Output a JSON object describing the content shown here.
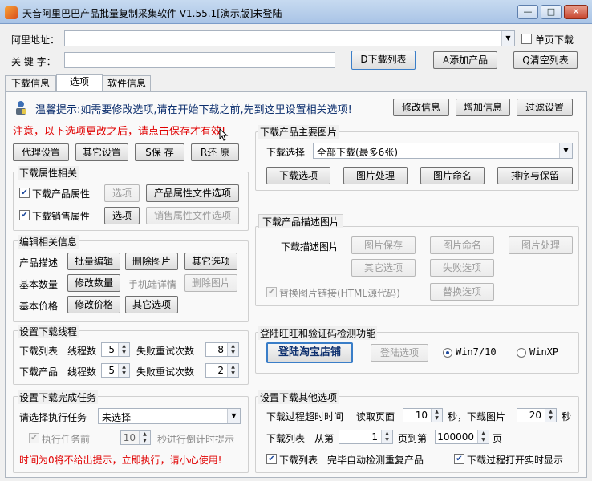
{
  "window": {
    "title": "天音阿里巴巴产品批量复制采集软件 V1.55.1[演示版]未登陆",
    "controls": {
      "minimize": "—",
      "maximize": "□",
      "close": "✕"
    }
  },
  "top": {
    "ali_label": "阿里地址：",
    "ali_value": "",
    "single_page_label": "单页下载",
    "keyword_label": "关 键 字：",
    "keyword_value": "",
    "btn_download_list": "D下载列表",
    "btn_add_product": "A添加产品",
    "btn_clear_list": "Q清空列表"
  },
  "tabs": [
    "下载信息",
    "选项",
    "软件信息"
  ],
  "hint": {
    "text": "温馨提示:如需要修改选项,请在开始下载之前,先到这里设置相关选项!",
    "btn_modify": "修改信息",
    "btn_add": "增加信息",
    "btn_filter": "过滤设置"
  },
  "notice": "注意，以下选项更改之后，请点击保存才有效!",
  "actions": {
    "proxy": "代理设置",
    "other": "其它设置",
    "save": "S保 存",
    "restore": "R还 原"
  },
  "attr_group": {
    "title": "下载属性相关",
    "row1_label": "下载产品属性",
    "row1_opt": "选项",
    "row1_file": "产品属性文件选项",
    "row2_label": "下载销售属性",
    "row2_opt": "选项",
    "row2_file": "销售属性文件选项"
  },
  "edit_group": {
    "title": "编辑相关信息",
    "desc_label": "产品描述",
    "desc_b1": "批量编辑",
    "desc_b2": "删除图片",
    "desc_b3": "其它选项",
    "qty_label": "基本数量",
    "qty_b1": "修改数量",
    "qty_mobile": "手机端详情",
    "qty_b2": "删除图片",
    "price_label": "基本价格",
    "price_b1": "修改价格",
    "price_b2": "其它选项"
  },
  "thread_group": {
    "title": "设置下载线程",
    "list_label": "下载列表",
    "product_label": "下载产品",
    "threads_label": "线程数",
    "retry_label": "失败重试次数",
    "list_threads": "5",
    "list_retry": "8",
    "product_threads": "5",
    "product_retry": "2"
  },
  "task_group": {
    "title": "设置下载完成任务",
    "select_label": "请选择执行任务",
    "select_value": "未选择",
    "before_label": "执行任务前",
    "before_value": "10",
    "countdown_label": "秒进行倒计时提示",
    "warning": "时间为0将不给出提示，立即执行，请小心使用!"
  },
  "main_img_group": {
    "title": "下载产品主要图片",
    "select_label": "下载选择",
    "select_value": "全部下载(最多6张)",
    "b1": "下载选项",
    "b2": "图片处理",
    "b3": "图片命名",
    "b4": "排序与保留"
  },
  "desc_img_group": {
    "title": "下载产品描述图片",
    "download_label": "下载描述图片",
    "b_save": "图片保存",
    "b_name": "图片命名",
    "b_process": "图片处理",
    "b_other": "其它选项",
    "b_fail": "失败选项",
    "replace_label": "替换图片链接(HTML源代码)",
    "b_replace": "替换选项"
  },
  "login_group": {
    "title": "登陆旺旺和验证码检测功能",
    "b_login_shop": "登陆淘宝店铺",
    "b_login_opt": "登陆选项",
    "radio_win7": "Win7/10",
    "radio_winxp": "WinXP"
  },
  "other_group": {
    "title": "设置下载其他选项",
    "timeout_label": "下载过程超时时间",
    "read_page_label": "读取页面",
    "read_page_value": "10",
    "sec_download_img": "秒，下载图片",
    "img_timeout_value": "20",
    "sec": "秒",
    "list_label": "下载列表",
    "from_label": "从第",
    "from_value": "1",
    "to_label": "页到第",
    "to_value": "100000",
    "page": "页",
    "auto_check_label": "下载列表",
    "auto_check_text": "完毕自动检测重复产品",
    "realtime_label": "下载过程打开实时显示"
  }
}
